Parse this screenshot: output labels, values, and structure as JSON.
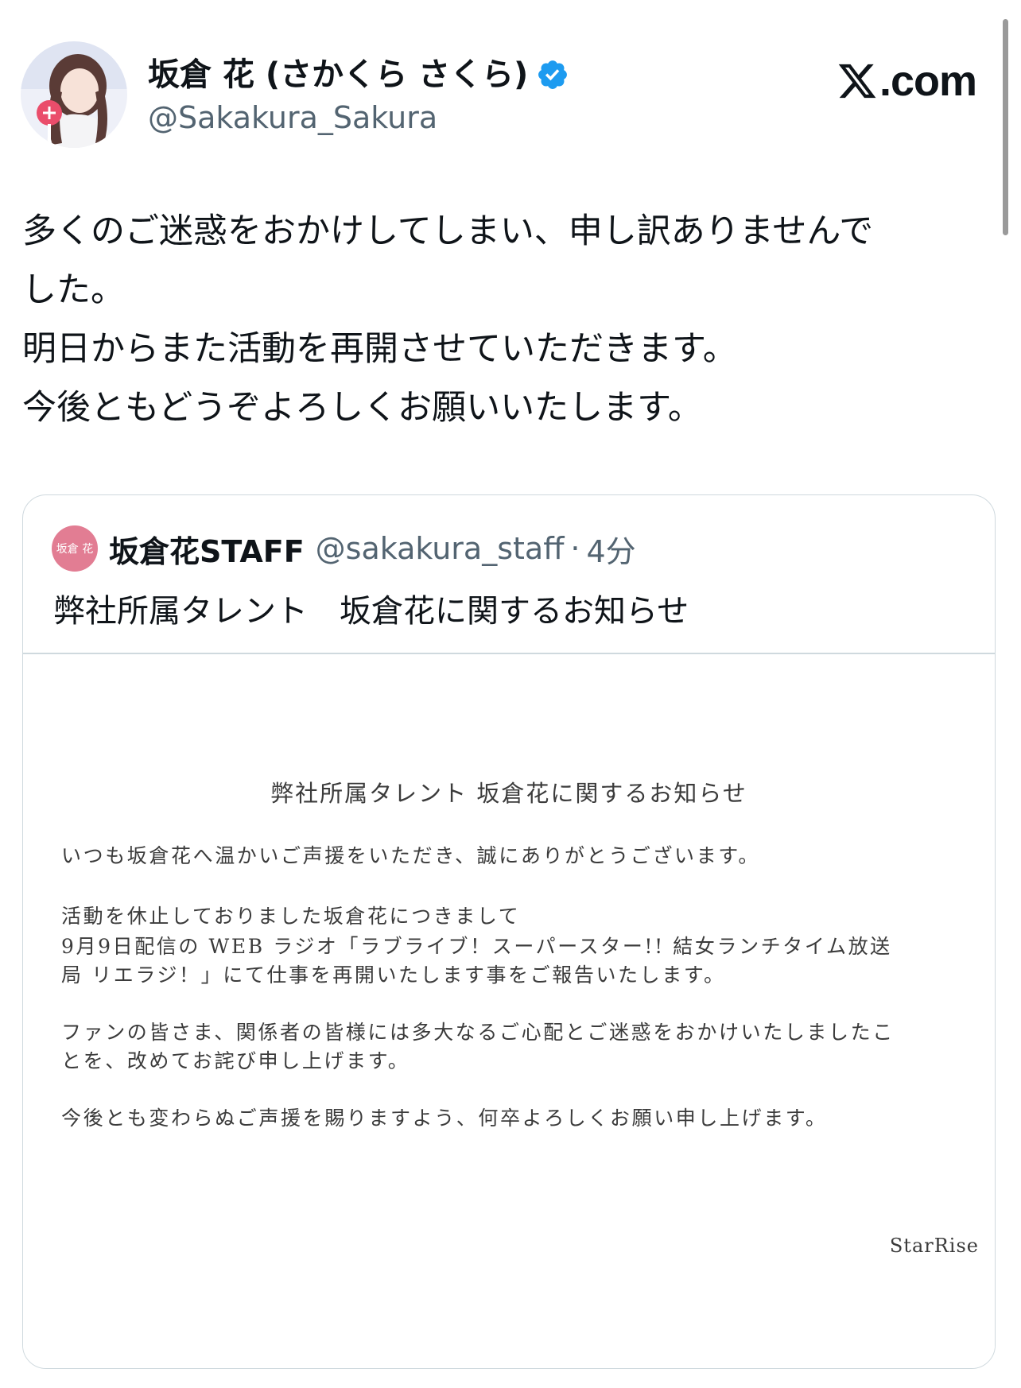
{
  "profile": {
    "display_name": "坂倉 花 (さかくら さくら)",
    "handle": "@Sakakura_Sakura",
    "verified": true
  },
  "site": {
    "logo_text": ".com",
    "logo_icon": "x-logo-icon"
  },
  "tweet": {
    "lines": [
      "多くのご迷惑をおかけしてしまい、申し訳ありませんで",
      "した。",
      "明日からまた活動を再開させていただきます。",
      "今後ともどうぞよろしくお願いいたします。"
    ]
  },
  "quote": {
    "name": "坂倉花STAFF",
    "handle": "@sakakura_staff",
    "separator": "·",
    "time": "4分",
    "text": "弊社所属タレント　坂倉花に関するお知らせ",
    "avatar_text": "坂倉 花",
    "notice": {
      "title": "弊社所属タレント 坂倉花に関するお知らせ",
      "lines": [
        "いつも坂倉花へ温かいご声援をいただき、誠にありがとうございます。",
        "活動を休止しておりました坂倉花につきまして",
        "9月9日配信の WEB ラジオ「ラブライブ！スーパースター!! 結女ランチタイム放送",
        "局 リエラジ！」にて仕事を再開いたします事をご報告いたします。",
        "ファンの皆さま、関係者の皆様には多大なるご心配とご迷惑をおかけいたしましたこ",
        "とを、改めてお詫び申し上げます。",
        "今後とも変わらぬご声援を賜りますよう、何卒よろしくお願い申し上げます。"
      ],
      "signature": "StarRise"
    }
  },
  "colors": {
    "verified": "#1d9bf0",
    "secondary_text": "#536471",
    "border": "#cfd9de",
    "staff_avatar": "#e27d93"
  }
}
